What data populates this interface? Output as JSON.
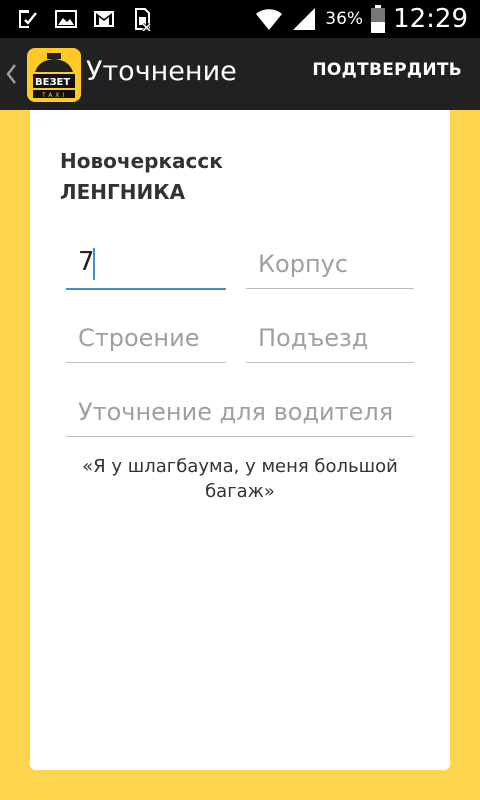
{
  "status_bar": {
    "battery_percent": "36%",
    "time": "12:29",
    "icons": [
      "download-done-icon",
      "image-icon",
      "gmail-icon",
      "sim-card-icon",
      "wifi-icon",
      "signal-icon",
      "battery-icon"
    ]
  },
  "action_bar": {
    "title": "Уточнение",
    "confirm_label": "ПОДТВЕРДИТЬ",
    "logo_text": "ВЕЗЕТ",
    "logo_subtext": "TAXI"
  },
  "address": {
    "city": "Новочеркасск",
    "street": "ЛЕНГНИКА"
  },
  "form": {
    "house": {
      "value": "7"
    },
    "building": {
      "placeholder": "Корпус"
    },
    "structure": {
      "placeholder": "Строение"
    },
    "entrance": {
      "placeholder": "Подъезд"
    },
    "driver_note": {
      "placeholder": "Уточнение для водителя"
    },
    "hint": "«Я у шлагбаума, у меня большой багаж»"
  },
  "colors": {
    "background": "#ffd54f",
    "action_bar": "#212121",
    "accent": "#3d8fd6",
    "card": "#ffffff"
  }
}
